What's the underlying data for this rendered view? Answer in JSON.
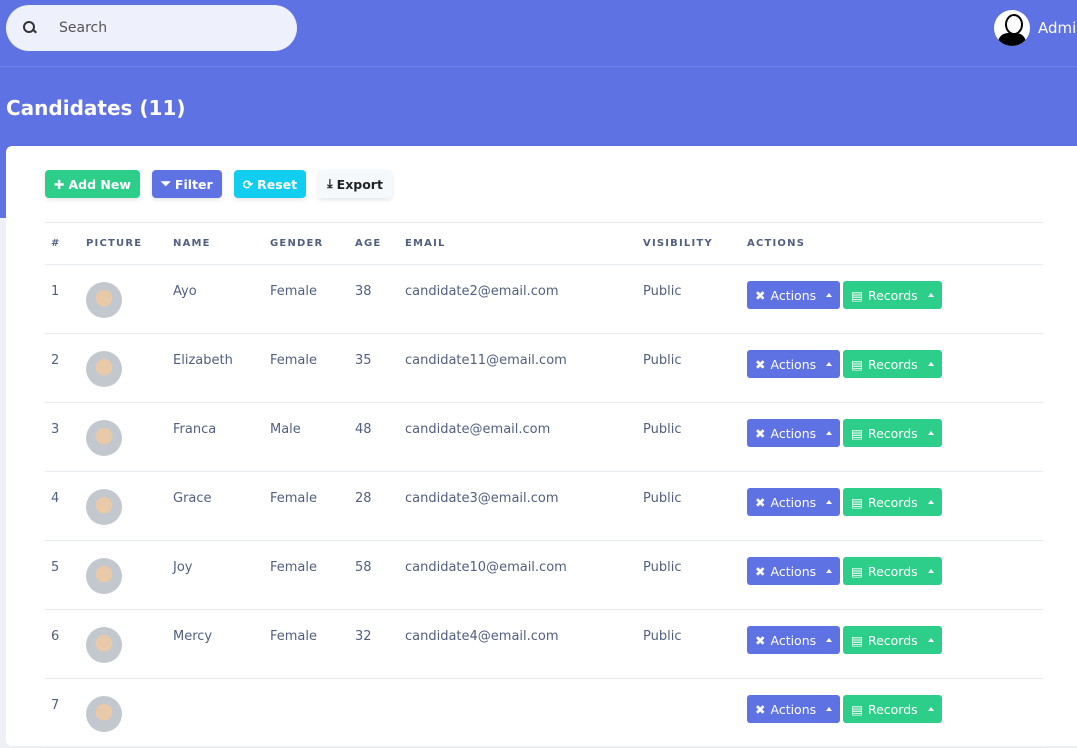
{
  "header": {
    "search_placeholder": "Search",
    "user_name": "Admin"
  },
  "page": {
    "title": "Candidates (11)"
  },
  "toolbar": {
    "add": "Add New",
    "filter": "Filter",
    "reset": "Reset",
    "export": "Export"
  },
  "table": {
    "headers": [
      "#",
      "PICTURE",
      "NAME",
      "GENDER",
      "AGE",
      "EMAIL",
      "VISIBILITY",
      "ACTIONS"
    ],
    "actions_label": "Actions",
    "records_label": "Records",
    "rows": [
      {
        "n": "1",
        "name": "Ayo",
        "gender": "Female",
        "age": "38",
        "email": "candidate2@email.com",
        "visibility": "Public"
      },
      {
        "n": "2",
        "name": "Elizabeth",
        "gender": "Female",
        "age": "35",
        "email": "candidate11@email.com",
        "visibility": "Public"
      },
      {
        "n": "3",
        "name": "Franca",
        "gender": "Male",
        "age": "48",
        "email": "candidate@email.com",
        "visibility": "Public"
      },
      {
        "n": "4",
        "name": "Grace",
        "gender": "Female",
        "age": "28",
        "email": "candidate3@email.com",
        "visibility": "Public"
      },
      {
        "n": "5",
        "name": "Joy",
        "gender": "Female",
        "age": "58",
        "email": "candidate10@email.com",
        "visibility": "Public"
      },
      {
        "n": "6",
        "name": "Mercy",
        "gender": "Female",
        "age": "32",
        "email": "candidate4@email.com",
        "visibility": "Public"
      },
      {
        "n": "7"
      }
    ]
  },
  "colors": {
    "primary": "#5e72e4",
    "success": "#2dce89",
    "info": "#11cdef"
  }
}
